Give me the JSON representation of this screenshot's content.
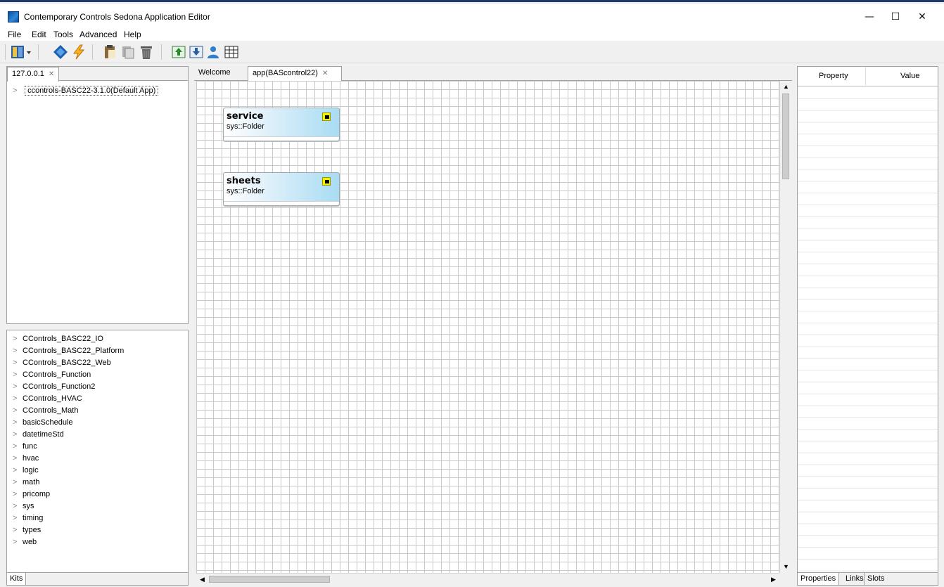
{
  "window": {
    "title": "Contemporary Controls Sedona Application Editor",
    "controls": {
      "minimize": "—",
      "maximize": "☐",
      "close": "✕"
    }
  },
  "menu": [
    "File",
    "Edit",
    "Tools",
    "Advanced",
    "Help"
  ],
  "toolbar": {
    "icons": [
      "layout-icon",
      "dropdown-arrow-icon",
      "connect-icon",
      "lightning-icon",
      "paste-icon",
      "copy-icon",
      "delete-icon",
      "upload-icon",
      "download-icon",
      "user-icon",
      "grid-icon"
    ]
  },
  "device_panel": {
    "tab_label": "127.0.0.1",
    "tree": [
      {
        "label": "ccontrols-BASC22-3.1.0(Default App)"
      }
    ]
  },
  "kits_panel": {
    "tab_label": "Kits",
    "items": [
      "CControls_BASC22_IO",
      "CControls_BASC22_Platform",
      "CControls_BASC22_Web",
      "CControls_Function",
      "CControls_Function2",
      "CControls_HVAC",
      "CControls_Math",
      "basicSchedule",
      "datetimeStd",
      "func",
      "hvac",
      "logic",
      "math",
      "pricomp",
      "sys",
      "timing",
      "types",
      "web"
    ]
  },
  "editor": {
    "tabs": [
      {
        "label": "Welcome",
        "active": false
      },
      {
        "label": "app(BAScontrol22)",
        "active": true
      }
    ],
    "components": [
      {
        "name": "service",
        "type": "sys::Folder"
      },
      {
        "name": "sheets",
        "type": "sys::Folder"
      }
    ]
  },
  "properties_panel": {
    "columns": [
      "Property",
      "Value"
    ],
    "bottom_tabs": [
      "Properties",
      "Links",
      "Slots"
    ]
  },
  "colors": {
    "component_gradient": "#a9dcf3",
    "badge": "#f3f100",
    "grid_line": "#c9c9c9"
  }
}
